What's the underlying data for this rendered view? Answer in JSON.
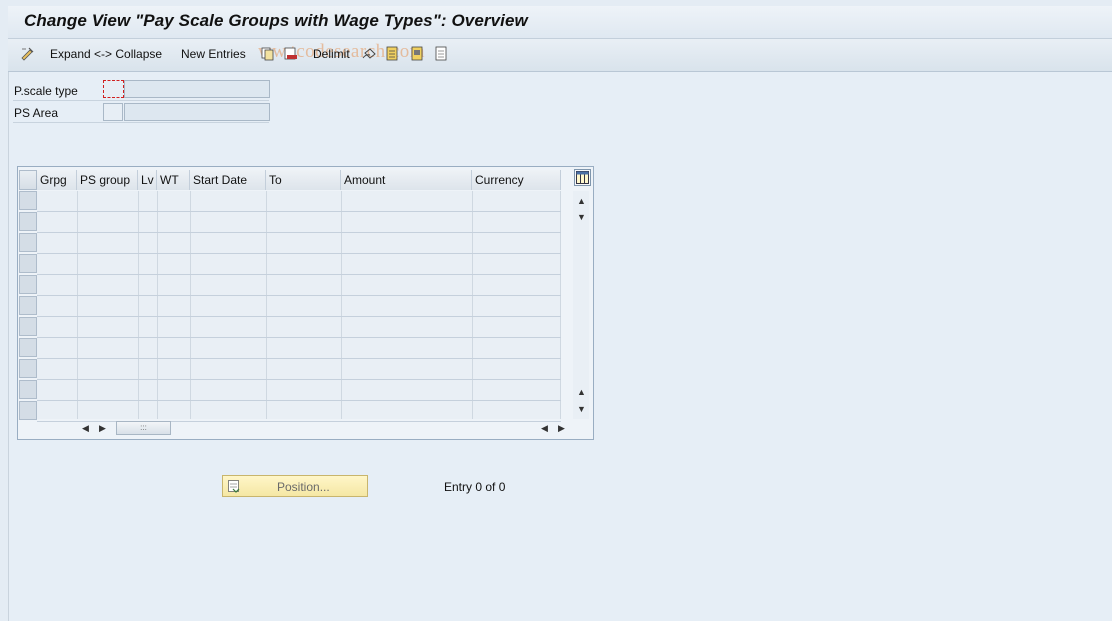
{
  "window": {
    "title": "Change View \"Pay Scale Groups with Wage Types\": Overview"
  },
  "toolbar": {
    "expand_collapse_label": "Expand <-> Collapse",
    "new_entries_label": "New Entries",
    "delimit_label": "Delimit",
    "watermark": "ww.tcodesearch.com"
  },
  "form": {
    "pscale_type_label": "P.scale type",
    "ps_area_label": "PS Area",
    "pscale_type_value": "",
    "pscale_type_text": "",
    "ps_area_value": "",
    "ps_area_text": ""
  },
  "table": {
    "columns": [
      "Grpg",
      "PS group",
      "Lv",
      "WT",
      "Start Date",
      "To",
      "Amount",
      "Currency"
    ],
    "rows": []
  },
  "footer": {
    "position_label": "Position...",
    "entry_text": "Entry 0 of 0"
  },
  "colors": {
    "background": "#e4ecf4",
    "button_yellow": "#f5e7a4",
    "focus_red": "#d02020"
  }
}
